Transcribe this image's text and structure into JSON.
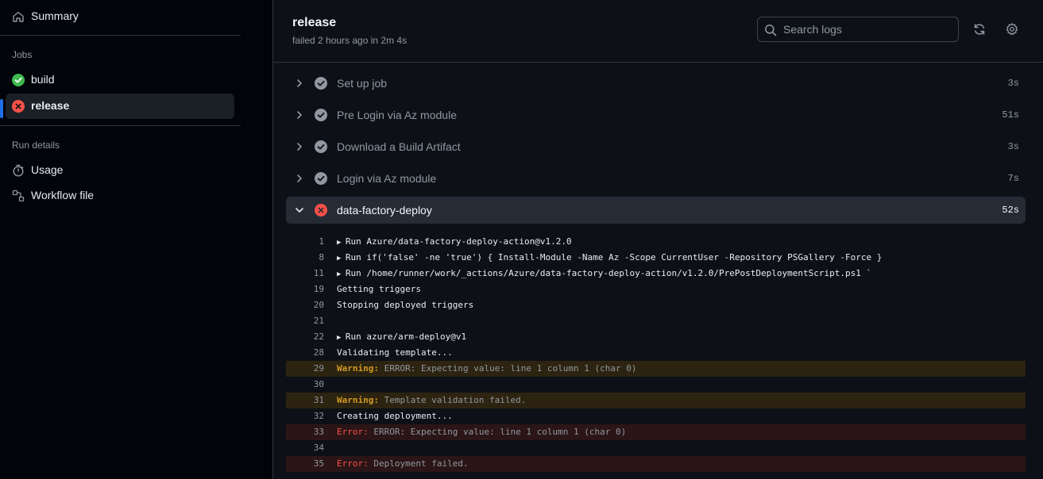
{
  "sidebar": {
    "summary_label": "Summary",
    "jobs_heading": "Jobs",
    "jobs": [
      {
        "label": "build",
        "status": "success"
      },
      {
        "label": "release",
        "status": "failure"
      }
    ],
    "run_details_heading": "Run details",
    "details": [
      {
        "label": "Usage",
        "icon": "stopwatch-icon"
      },
      {
        "label": "Workflow file",
        "icon": "workflow-file-icon"
      }
    ]
  },
  "header": {
    "title": "release",
    "subtitle": "failed 2 hours ago in 2m 4s",
    "search_placeholder": "Search logs"
  },
  "steps": [
    {
      "name": "Set up job",
      "duration": "3s",
      "status": "success"
    },
    {
      "name": "Pre Login via Az module",
      "duration": "51s",
      "status": "success"
    },
    {
      "name": "Download a Build Artifact",
      "duration": "3s",
      "status": "success"
    },
    {
      "name": "Login via Az module",
      "duration": "7s",
      "status": "success"
    },
    {
      "name": "data-factory-deploy",
      "duration": "52s",
      "status": "failure"
    }
  ],
  "log": [
    {
      "n": "1",
      "type": "group",
      "text": "Run Azure/data-factory-deploy-action@v1.2.0"
    },
    {
      "n": "8",
      "type": "group",
      "text": "Run if('false' -ne 'true') { Install-Module -Name Az -Scope CurrentUser -Repository PSGallery -Force }"
    },
    {
      "n": "11",
      "type": "group",
      "text": "Run /home/runner/work/_actions/Azure/data-factory-deploy-action/v1.2.0/PrePostDeploymentScript.ps1 `"
    },
    {
      "n": "19",
      "type": "plain",
      "text": "Getting triggers"
    },
    {
      "n": "20",
      "type": "plain",
      "text": "Stopping deployed triggers"
    },
    {
      "n": "21",
      "type": "plain",
      "text": ""
    },
    {
      "n": "22",
      "type": "group",
      "text": "Run azure/arm-deploy@v1"
    },
    {
      "n": "28",
      "type": "plain",
      "text": "Validating template..."
    },
    {
      "n": "29",
      "type": "warning",
      "prefix": "Warning:",
      "text": "ERROR: Expecting value: line 1 column 1 (char 0)"
    },
    {
      "n": "30",
      "type": "plain",
      "text": ""
    },
    {
      "n": "31",
      "type": "warning",
      "prefix": "Warning:",
      "text": "Template validation failed."
    },
    {
      "n": "32",
      "type": "plain",
      "text": "Creating deployment..."
    },
    {
      "n": "33",
      "type": "error",
      "prefix": "Error:",
      "text": "ERROR: Expecting value: line 1 column 1 (char 0)"
    },
    {
      "n": "34",
      "type": "plain",
      "text": ""
    },
    {
      "n": "35",
      "type": "error",
      "prefix": "Error:",
      "text": "Deployment failed."
    }
  ],
  "colors": {
    "success": "#3fb950",
    "failure": "#f85149",
    "warning": "#d29922",
    "accent": "#1f6feb"
  }
}
